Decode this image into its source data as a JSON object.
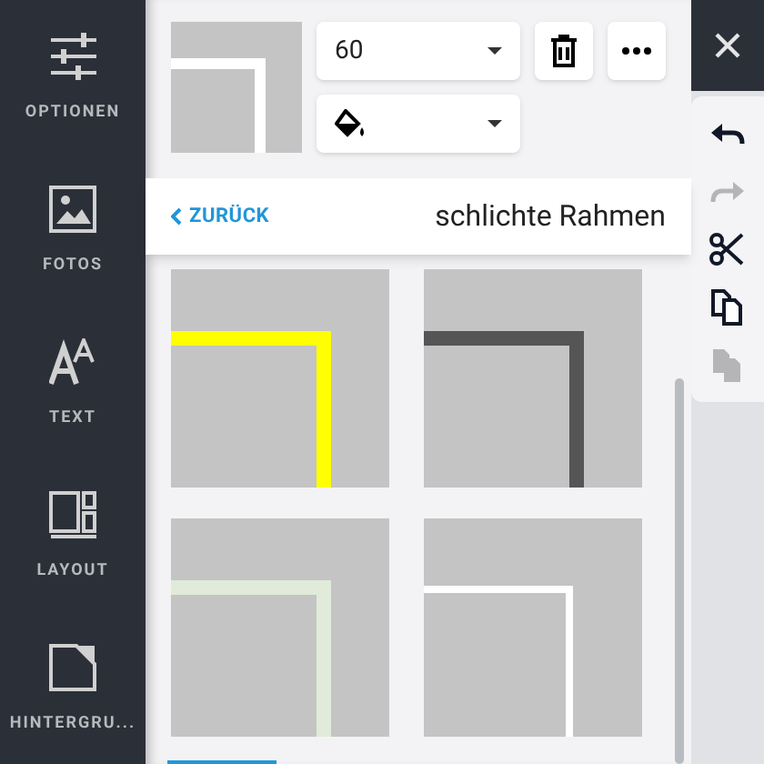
{
  "sidebar": {
    "items": [
      {
        "label": "OPTIONEN"
      },
      {
        "label": "FOTOS"
      },
      {
        "label": "TEXT"
      },
      {
        "label": "LAYOUT"
      },
      {
        "label": "HINTERGRU..."
      }
    ]
  },
  "preview": {
    "color": "#ffffff"
  },
  "size_dropdown": {
    "value": "60"
  },
  "header": {
    "back": "ZURÜCK",
    "title": "schlichte Rahmen"
  },
  "frames": [
    {
      "color": "#ffff00",
      "kind": "thick"
    },
    {
      "color": "#555555",
      "kind": "thick"
    },
    {
      "color": "#e0ebd9",
      "kind": "thick"
    },
    {
      "color": "#ffffff",
      "kind": "thin"
    }
  ],
  "toolbar": [
    {
      "disabled": false
    },
    {
      "disabled": true
    },
    {
      "disabled": false
    },
    {
      "disabled": false
    },
    {
      "disabled": true
    }
  ]
}
